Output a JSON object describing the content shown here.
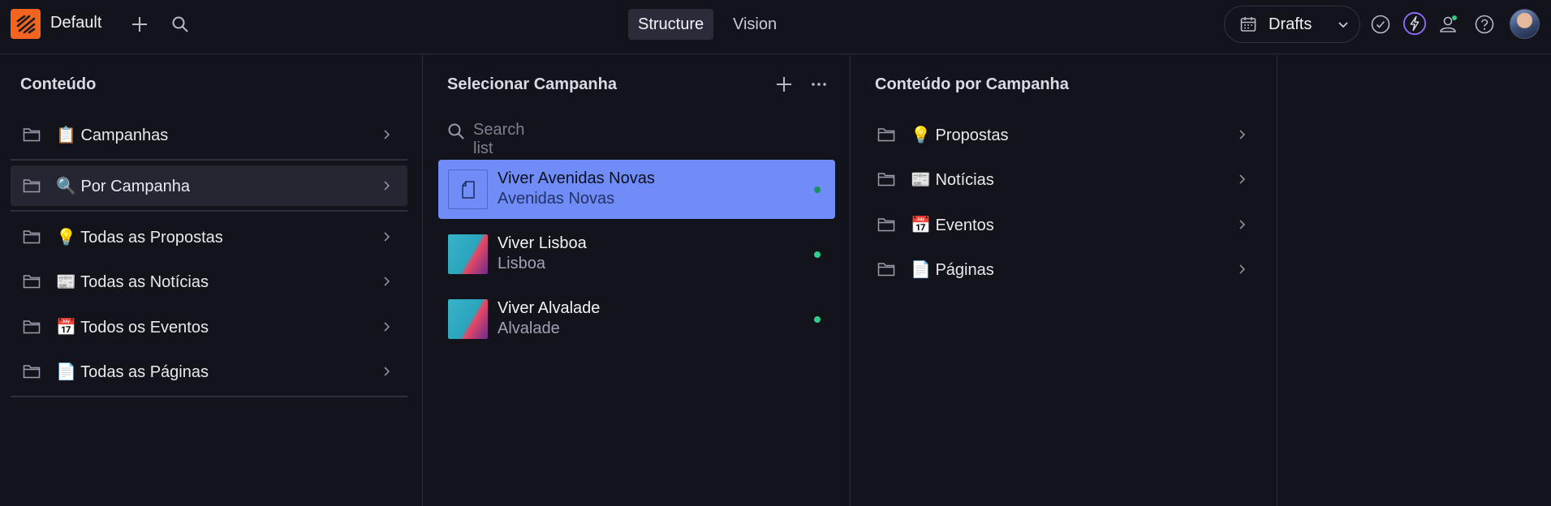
{
  "topbar": {
    "workspace": "Default",
    "tabs": [
      {
        "label": "Structure",
        "active": true
      },
      {
        "label": "Vision",
        "active": false
      }
    ],
    "release": {
      "label": "Drafts"
    }
  },
  "panes": {
    "content": {
      "title": "Conteúdo",
      "items": [
        {
          "label": "📋 Campanhas",
          "selected": false
        },
        {
          "label": "🔍 Por Campanha",
          "selected": true
        },
        {
          "label": "💡 Todas as Propostas",
          "selected": false
        },
        {
          "label": "📰 Todas as Notícias",
          "selected": false
        },
        {
          "label": "📅 Todos os Eventos",
          "selected": false
        },
        {
          "label": "📄 Todas as Páginas",
          "selected": false
        }
      ]
    },
    "campaigns": {
      "title": "Selecionar Campanha",
      "search_placeholder": "Search list",
      "items": [
        {
          "title": "Viver Avenidas Novas",
          "subtitle": "Avenidas Novas",
          "active": true
        },
        {
          "title": "Viver Lisboa",
          "subtitle": "Lisboa",
          "active": false
        },
        {
          "title": "Viver Alvalade",
          "subtitle": "Alvalade",
          "active": false
        }
      ]
    },
    "by_campaign": {
      "title": "Conteúdo por Campanha",
      "items": [
        {
          "label": "💡 Propostas"
        },
        {
          "label": "📰 Notícias"
        },
        {
          "label": "📅 Eventos"
        },
        {
          "label": "📄 Páginas"
        }
      ]
    }
  },
  "colors": {
    "background": "#13141b",
    "accent": "#6f8cf7",
    "logo": "#f36421",
    "status_dot": "#2fcc8a"
  },
  "icons": [
    "search-icon",
    "plus-icon",
    "calendar-icon",
    "chevron-down-icon",
    "check-circle-icon",
    "bolt-icon",
    "users-icon",
    "help-icon",
    "folder-icon",
    "chevron-right-icon",
    "more-icon",
    "document-icon"
  ]
}
